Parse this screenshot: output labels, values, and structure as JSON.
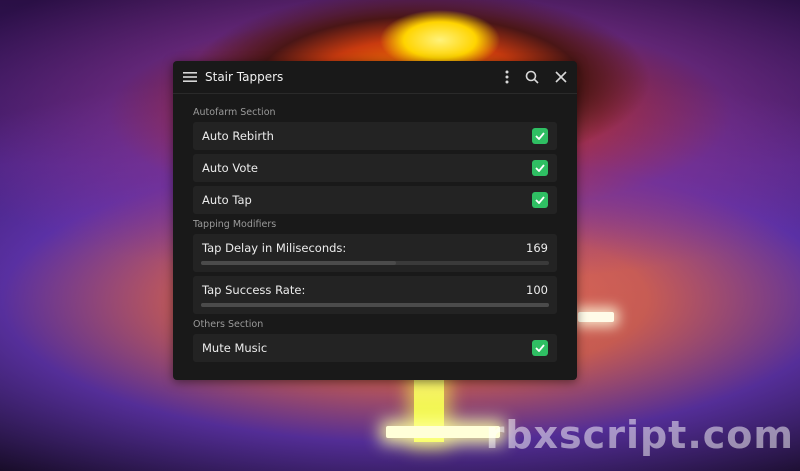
{
  "window": {
    "title": "Stair Tappers"
  },
  "sections": {
    "autofarm": {
      "label": "Autofarm Section",
      "items": [
        {
          "label": "Auto Rebirth",
          "checked": true
        },
        {
          "label": "Auto Vote",
          "checked": true
        },
        {
          "label": "Auto Tap",
          "checked": true
        }
      ]
    },
    "modifiers": {
      "label": "Tapping Modifiers",
      "sliders": [
        {
          "label": "Tap Delay in Miliseconds:",
          "value": "169",
          "fill_fraction": 0.56
        },
        {
          "label": "Tap Success Rate:",
          "value": "100",
          "fill_fraction": 1.0
        }
      ]
    },
    "others": {
      "label": "Others Section",
      "items": [
        {
          "label": "Mute Music",
          "checked": true
        }
      ]
    }
  },
  "icons": {
    "menu": "hamburger-menu-icon",
    "more": "vertical-dots-icon",
    "search": "search-icon",
    "close": "close-icon",
    "check": "checkmark-icon"
  },
  "colors": {
    "check_accent": "#2fbf63",
    "panel": "#191919",
    "row": "#232323"
  },
  "watermark": "rbxscript.com"
}
